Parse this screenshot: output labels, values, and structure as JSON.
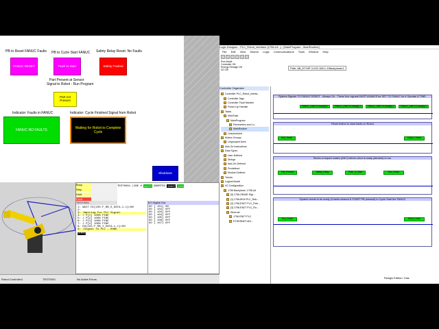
{
  "hmi": {
    "labels": {
      "reset_faults": "PB to Reset FANUC Faults",
      "cycle_start": "PB to Cycle Start FANUC",
      "safety_reset": "Safety Relay Reset: No Faults",
      "part_sensor": "Part Present at Sensor",
      "signal_robot": "Signal to Robot - Run Program",
      "ind_faults": "Indicator: Faults in FANUC",
      "ind_cycle": "Indicator: Cycle Finished Signal from Robot"
    },
    "buttons": {
      "reset": "FANUC RESET",
      "start": "Push to Start",
      "safety": "Safety Faulted",
      "part": "Part not Present",
      "shutdown": "Shutdown"
    },
    "indicators": {
      "faults": "FANUC NO FAULTS",
      "cycle": "Waiting for Robot to Complete Cycle"
    },
    "colors": {
      "reset": "#ff00ff",
      "start": "#ff00ff",
      "safety": "#ff0000",
      "part": "#ffff00",
      "faults": "#00dd00",
      "cycle_bg": "#000000",
      "cycle_fg": "#ffff00",
      "shutdown": "#0000cc"
    }
  },
  "pendant": {
    "status": [
      "Busy",
      "Step",
      "Hold",
      "Fault"
    ],
    "prog": "TEST0001",
    "header": "TEST0001 LINE 0",
    "auto": "AUTO",
    "aborted": "ABORTED",
    "joint": "JOINT",
    "pct": "10%",
    "io_title": "I/O Digital Out",
    "lines": [
      "1: WAIT DI[105:F_RB_S_DATA-1.1]=ON",
      "2:",
      "3: !Waiting For PLC Signal",
      "4: J P[1] 100% FINE",
      "5: J P[2] 100% FINE",
      "6: J P[3] 100% FINE",
      "7: J P[4] 100% FINE",
      "8: DO[101:F_RB_I_DATA-1.1]=ON",
      "9: !Signal To PLC - DONE",
      "[End]"
    ],
    "io_rows": [
      "DO [ 101] ON",
      "DO [ 102] OFF",
      "DO [ 103] OFF",
      "DO [ 104] OFF",
      "DO [ 105] OFF",
      "DO [ 106] OFF",
      "DO [ 107] OFF"
    ]
  },
  "rslogix": {
    "title": "Logix Designer - PLC_Robot_interface [1756-L8...] - [MainProgram - MainRoutine]",
    "menu": [
      "File",
      "Edit",
      "View",
      "Search",
      "Logic",
      "Communications",
      "Tools",
      "Window",
      "Help"
    ],
    "status": [
      "Run Mode",
      "Controller OK",
      "Energy Storage OK",
      "I/O OK"
    ],
    "path": "Path: AB_ETHIP-1\\192.168.1.1\\Backplane\\1",
    "organizer_title": "Controller Organizer",
    "tree": [
      "Controller PLC_Robot_interfa...",
      "Controller Tags",
      "Controller Fault Handler",
      "Power-Up Handler",
      "Tasks",
      "MainTask",
      "MainProgram",
      "Parameters and Lo...",
      "MainRoutine",
      "Unscheduled",
      "Motion Groups",
      "Ungrouped Axes",
      "Add-On Instructions",
      "Data Types",
      "User-Defined",
      "Strings",
      "Add-On-Defined",
      "Predefined",
      "Module-Defined",
      "Trends",
      "Logical Model",
      "I/O Configuration",
      "1756 Backplane, 1756-A4",
      "[0] 1756-OB16E Digi...",
      "[1] 1756-IB16 PLC_Rob...",
      "[2] 1756-EN2T PLC_Rob...",
      "[3] 1756-EN2T PLC_Ro...",
      "Ethernet",
      "1756-EN2T PLC",
      "ETHERNET-MO..."
    ],
    "rungs": [
      {
        "title": "System Signals TO FANUC ROBOT - Always On - These four signals MUST ALWAYS be SET TO FANUC for it Operate & TIME."
      },
      {
        "title": "Reset button to clear faults on Robot"
      },
      {
        "title": "Series of require states (ANY) before robot is ready (abruted) to run."
      },
      {
        "title": "System needs to be ready (4 faults cleared & START PB pressed) to Cycle Start the FANUC"
      }
    ],
    "instr": [
      "FANUC_ENET:O.Data[0].0",
      "FANUC_ENET:O.Data[0].1",
      "FANUC_ENET:O.Data[0].2",
      "FANUC_ENET:O.Data[0].3",
      "HMI_Reset",
      "FANUC Reset",
      "Part_Present",
      "Safety_Relay",
      "Push_to_Start",
      "Run_Robot",
      "Robot_Done"
    ]
  },
  "taskbar": {
    "items": [
      "Robot Controller1",
      "TEST0001",
      "No Active Errors"
    ],
    "right": "Rslogix Edition: Clas"
  }
}
